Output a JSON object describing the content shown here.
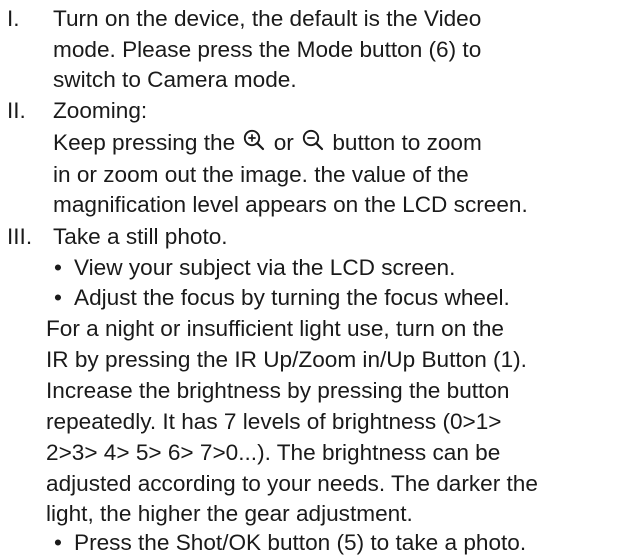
{
  "steps": [
    {
      "numeral": "I.",
      "lines": [
        "Turn on the device, the default is the Video",
        "mode. Please press the Mode button (6) to",
        "switch to Camera mode."
      ]
    },
    {
      "numeral": "II.",
      "heading": "Zooming:",
      "zoom_line_before": "Keep pressing the",
      "zoom_line_or": "or",
      "zoom_line_after": "button to zoom",
      "zoom_in_icon": "zoom-in-icon",
      "zoom_out_icon": "zoom-out-icon",
      "lines": [
        "in or zoom out the image. the value of the",
        "magnification level appears on the LCD screen."
      ]
    },
    {
      "numeral": "III.",
      "heading": "Take a still photo.",
      "bullet": "•",
      "bullets": [
        "View your subject via the LCD screen.",
        "Adjust the focus by turning the focus wheel."
      ],
      "paragraph": [
        "For a night or insufficient light use, turn on the",
        "IR by pressing the IR Up/Zoom in/Up Button (1).",
        "Increase the brightness by pressing the button",
        "repeatedly. It has 7 levels of brightness (0>1>",
        "2>3> 4> 5> 6> 7>0...). The brightness can be",
        "adjusted according to your needs. The darker the",
        "light, the higher the gear adjustment."
      ],
      "last_bullet": "Press the Shot/OK button (5) to take a photo."
    }
  ],
  "colors": {
    "text": "#1a1a1a",
    "background": "#ffffff"
  }
}
